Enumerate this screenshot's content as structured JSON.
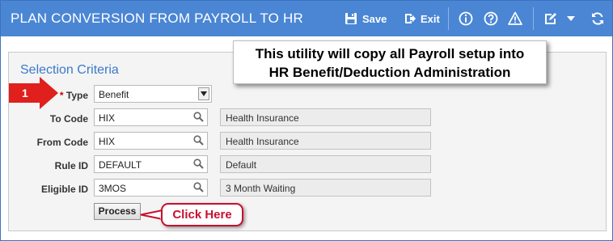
{
  "window": {
    "title": "PLAN CONVERSION FROM PAYROLL TO HR"
  },
  "toolbar": {
    "save_label": "Save",
    "exit_label": "Exit",
    "icons": [
      "save-icon",
      "exit-icon",
      "info-icon",
      "help-icon",
      "warning-icon",
      "edit-icon",
      "dropdown-icon",
      "refresh-icon"
    ]
  },
  "callout": {
    "line1": "This utility will copy all Payroll setup into",
    "line2": "HR Benefit/Deduction Administration"
  },
  "section": {
    "title": "Selection Criteria"
  },
  "step_marker": "1",
  "form": {
    "type": {
      "required_mark": "*",
      "label": "Type",
      "value": "Benefit"
    },
    "to_code": {
      "label": "To Code",
      "value": "HIX",
      "description": "Health Insurance"
    },
    "from_code": {
      "label": "From Code",
      "value": "HIX",
      "description": "Health Insurance"
    },
    "rule_id": {
      "label": "Rule ID",
      "value": "DEFAULT",
      "description": "Default"
    },
    "eligible_id": {
      "label": "Eligible ID",
      "value": "3MOS",
      "description": "3 Month Waiting"
    }
  },
  "process_button": "Process",
  "click_here": "Click Here",
  "colors": {
    "titlebar": "#4a86d4",
    "accent_title": "#3a7ac9",
    "required": "#cc0000",
    "callout_red": "#c8102e",
    "step_arrow": "#e0201c"
  }
}
